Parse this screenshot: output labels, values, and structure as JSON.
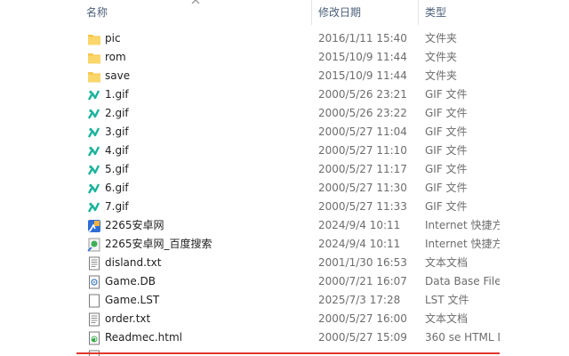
{
  "header": {
    "name": "名称",
    "date": "修改日期",
    "type": "类型"
  },
  "rows": [
    {
      "icon": "folder-icon",
      "name": "pic",
      "date": "2016/1/11 15:40",
      "type": "文件夹"
    },
    {
      "icon": "folder-icon",
      "name": "rom",
      "date": "2015/10/9 11:44",
      "type": "文件夹"
    },
    {
      "icon": "folder-icon",
      "name": "save",
      "date": "2015/10/9 11:44",
      "type": "文件夹"
    },
    {
      "icon": "gif-icon",
      "name": "1.gif",
      "date": "2000/5/26 23:21",
      "type": "GIF 文件"
    },
    {
      "icon": "gif-icon",
      "name": "2.gif",
      "date": "2000/5/26 23:22",
      "type": "GIF 文件"
    },
    {
      "icon": "gif-icon",
      "name": "3.gif",
      "date": "2000/5/27 11:04",
      "type": "GIF 文件"
    },
    {
      "icon": "gif-icon",
      "name": "4.gif",
      "date": "2000/5/27 11:10",
      "type": "GIF 文件"
    },
    {
      "icon": "gif-icon",
      "name": "5.gif",
      "date": "2000/5/27 11:17",
      "type": "GIF 文件"
    },
    {
      "icon": "gif-icon",
      "name": "6.gif",
      "date": "2000/5/27 11:30",
      "type": "GIF 文件"
    },
    {
      "icon": "gif-icon",
      "name": "7.gif",
      "date": "2000/5/27 11:33",
      "type": "GIF 文件"
    },
    {
      "icon": "internet-shortcut-icon",
      "name": "2265安卓网",
      "date": "2024/9/4 10:11",
      "type": "Internet 快捷方"
    },
    {
      "icon": "search-shortcut-icon",
      "name": "2265安卓网_百度搜索",
      "date": "2024/9/4 10:11",
      "type": "Internet 快捷方"
    },
    {
      "icon": "text-document-icon",
      "name": "disland.txt",
      "date": "2001/1/30 16:53",
      "type": "文本文档"
    },
    {
      "icon": "database-file-icon",
      "name": "Game.DB",
      "date": "2000/7/21 16:07",
      "type": "Data Base File"
    },
    {
      "icon": "text-document-icon",
      "name": "Game.LST",
      "date": "2025/7/3 17:28",
      "type": "LST 文件"
    },
    {
      "icon": "text-document-icon",
      "name": "order.txt",
      "date": "2000/5/27 16:00",
      "type": "文本文档"
    },
    {
      "icon": "html-file-icon",
      "name": "Readmec.html",
      "date": "2000/5/27 15:09",
      "type": "360 se HTML D"
    }
  ],
  "colors": {
    "folder": "#f5c64a",
    "gif": "#1bb39a",
    "divider": "#e0382a"
  }
}
